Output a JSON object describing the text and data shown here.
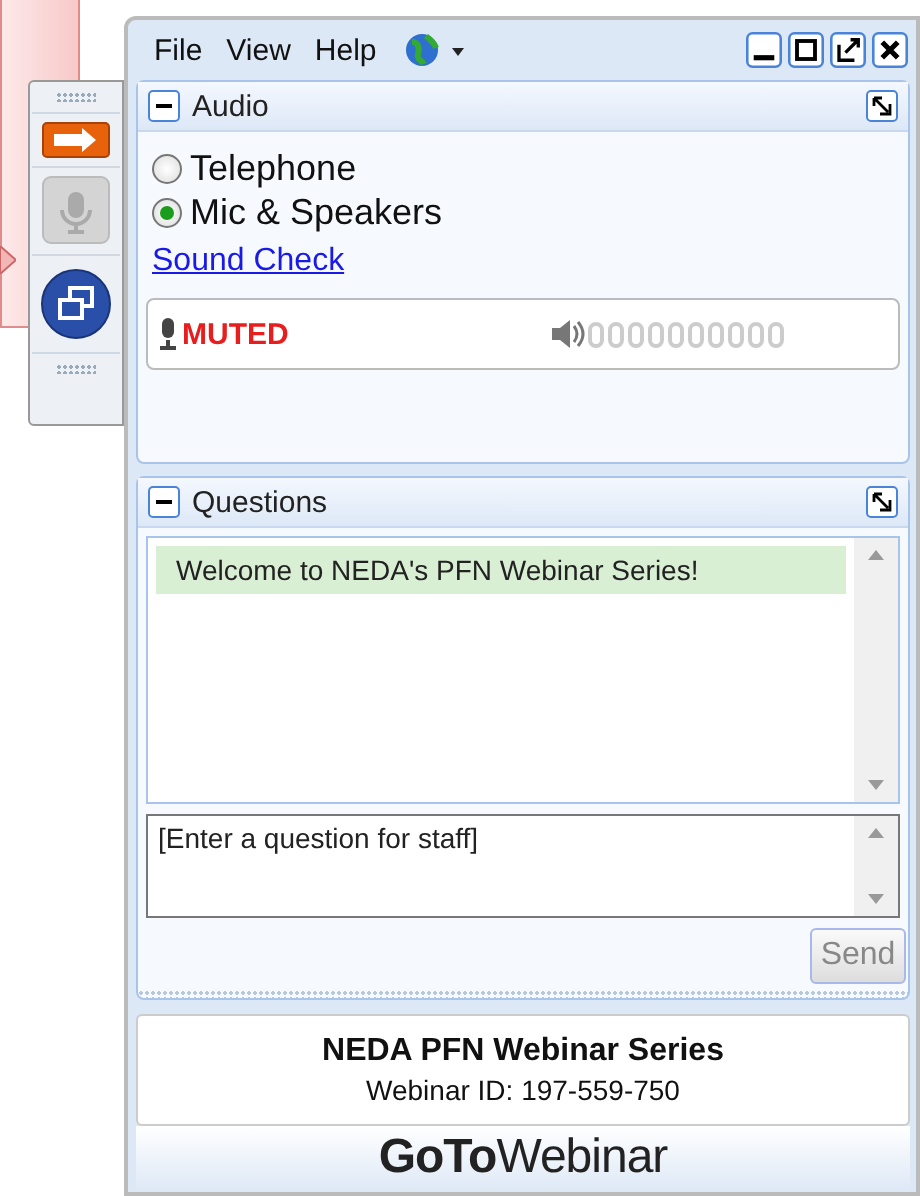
{
  "menu": [
    "File",
    "View",
    "Help"
  ],
  "audio": {
    "title": "Audio",
    "options": [
      {
        "label": "Telephone",
        "selected": false
      },
      {
        "label": "Mic & Speakers",
        "selected": true
      }
    ],
    "link": "Sound Check",
    "mic_status": "MUTED"
  },
  "questions": {
    "title": "Questions",
    "messages": [
      "Welcome to NEDA's PFN Webinar Series!"
    ],
    "placeholder": "[Enter a question for staff]",
    "send": "Send",
    "send_disabled": true
  },
  "info": {
    "title": "NEDA PFN Webinar Series",
    "webinar_id": "Webinar ID: 197-559-750"
  },
  "logo": "**GoTo**Webinar"
}
